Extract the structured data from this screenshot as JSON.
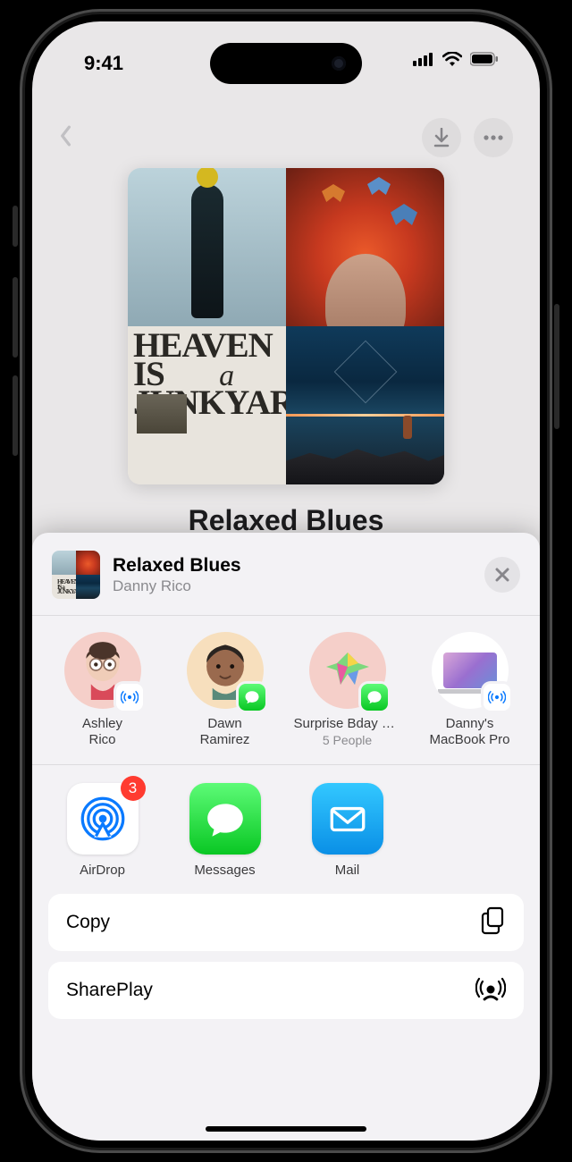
{
  "status": {
    "time": "9:41"
  },
  "playlist": {
    "title": "Relaxed Blues",
    "album_art_text": "HEAVEN IS a JUNKYARD"
  },
  "share_sheet": {
    "item_title": "Relaxed Blues",
    "item_subtitle": "Danny Rico",
    "contacts": [
      {
        "name": "Ashley\nRico",
        "sub": "",
        "badge": "airdrop"
      },
      {
        "name": "Dawn\nRamirez",
        "sub": "",
        "badge": "messages"
      },
      {
        "name": "Surprise Bday P…",
        "sub": "5 People",
        "badge": "messages"
      },
      {
        "name": "Danny's\nMacBook Pro",
        "sub": "",
        "badge": "airdrop"
      }
    ],
    "apps": [
      {
        "label": "AirDrop",
        "badge": "3"
      },
      {
        "label": "Messages",
        "badge": ""
      },
      {
        "label": "Mail",
        "badge": ""
      }
    ],
    "actions": [
      {
        "label": "Copy",
        "icon": "copy"
      },
      {
        "label": "SharePlay",
        "icon": "shareplay"
      }
    ]
  }
}
